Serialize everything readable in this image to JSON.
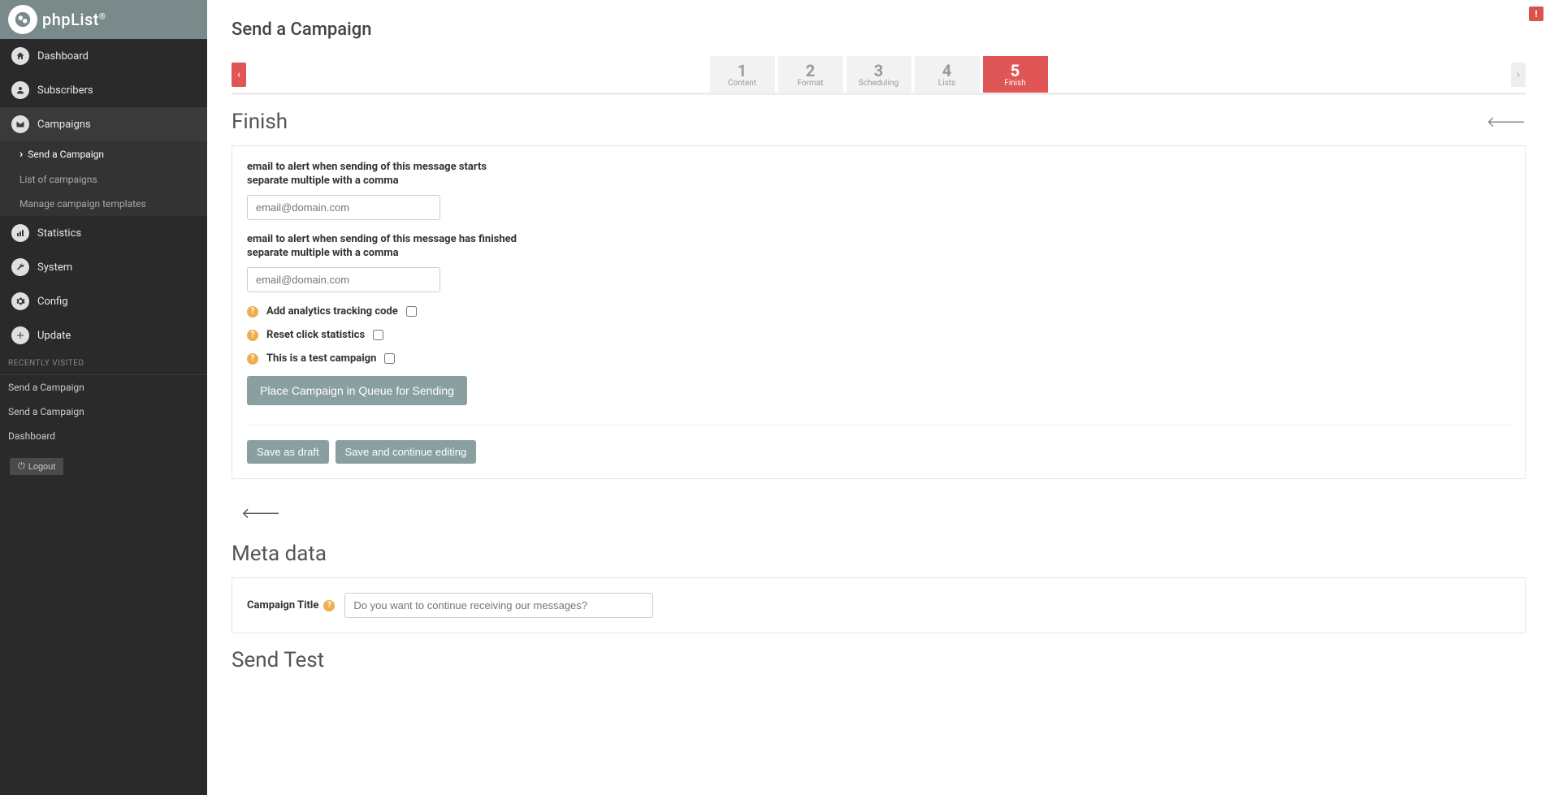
{
  "app_name": "phpList",
  "sidebar": {
    "items": [
      {
        "label": "Dashboard",
        "icon": "home"
      },
      {
        "label": "Subscribers",
        "icon": "user"
      },
      {
        "label": "Campaigns",
        "icon": "mail"
      },
      {
        "label": "Statistics",
        "icon": "chart"
      },
      {
        "label": "System",
        "icon": "wrench"
      },
      {
        "label": "Config",
        "icon": "gear"
      },
      {
        "label": "Update",
        "icon": "plus"
      }
    ],
    "campaigns_sub": [
      {
        "label": "Send a Campaign"
      },
      {
        "label": "List of campaigns"
      },
      {
        "label": "Manage campaign templates"
      }
    ],
    "recent_header": "RECENTLY VISITED",
    "recent": [
      {
        "label": "Send a Campaign"
      },
      {
        "label": "Send a Campaign"
      },
      {
        "label": "Dashboard"
      }
    ],
    "logout_label": "Logout"
  },
  "page": {
    "title": "Send a Campaign",
    "tabs": [
      {
        "num": "1",
        "label": "Content"
      },
      {
        "num": "2",
        "label": "Format"
      },
      {
        "num": "3",
        "label": "Scheduling"
      },
      {
        "num": "4",
        "label": "Lists"
      },
      {
        "num": "5",
        "label": "Finish"
      }
    ],
    "section_title": "Finish",
    "alert_start": {
      "label": "email to alert when sending of this message starts",
      "sub": "separate multiple with a comma",
      "placeholder": "email@domain.com"
    },
    "alert_end": {
      "label": "email to alert when sending of this message has finished",
      "sub": "separate multiple with a comma",
      "placeholder": "email@domain.com"
    },
    "opts": {
      "analytics": "Add analytics tracking code",
      "reset": "Reset click statistics",
      "test": "This is a test campaign"
    },
    "queue_btn": "Place Campaign in Queue for Sending",
    "save_draft": "Save as draft",
    "save_continue": "Save and continue editing",
    "meta_title": "Meta data",
    "campaign_title_label": "Campaign Title",
    "campaign_title_placeholder": "Do you want to continue receiving our messages?",
    "send_test_title": "Send Test"
  }
}
